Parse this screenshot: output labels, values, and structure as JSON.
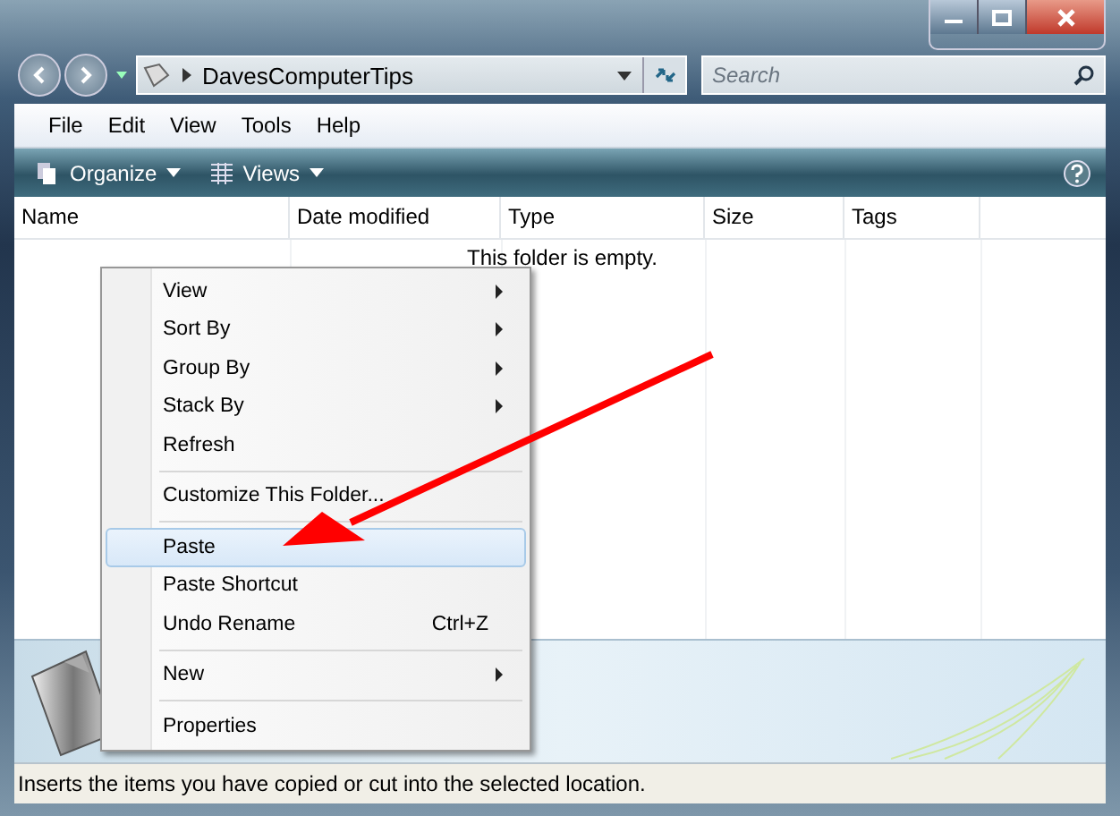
{
  "address_bar": {
    "path": "DavesComputerTips"
  },
  "search": {
    "placeholder": "Search"
  },
  "menu_bar": [
    "File",
    "Edit",
    "View",
    "Tools",
    "Help"
  ],
  "toolbar": [
    {
      "label": "Organize"
    },
    {
      "label": "Views"
    }
  ],
  "columns": [
    "Name",
    "Date modified",
    "Type",
    "Size",
    "Tags"
  ],
  "empty_message": "This folder is empty.",
  "context_menu": [
    {
      "kind": "item",
      "label": "View",
      "submenu": true,
      "selected": false
    },
    {
      "kind": "item",
      "label": "Sort By",
      "submenu": true,
      "selected": false
    },
    {
      "kind": "item",
      "label": "Group By",
      "submenu": true,
      "selected": false
    },
    {
      "kind": "item",
      "label": "Stack By",
      "submenu": true,
      "selected": false
    },
    {
      "kind": "item",
      "label": "Refresh",
      "submenu": false,
      "selected": false
    },
    {
      "kind": "separator"
    },
    {
      "kind": "item",
      "label": "Customize This Folder...",
      "submenu": false,
      "selected": false
    },
    {
      "kind": "separator"
    },
    {
      "kind": "item",
      "label": "Paste",
      "submenu": false,
      "selected": true
    },
    {
      "kind": "item",
      "label": "Paste Shortcut",
      "submenu": false,
      "selected": false
    },
    {
      "kind": "item",
      "label": "Undo Rename",
      "shortcut": "Ctrl+Z",
      "submenu": false,
      "selected": false
    },
    {
      "kind": "separator"
    },
    {
      "kind": "item",
      "label": "New",
      "submenu": true,
      "selected": false
    },
    {
      "kind": "separator"
    },
    {
      "kind": "item",
      "label": "Properties",
      "submenu": false,
      "selected": false
    }
  ],
  "status_bar": "Inserts the items you have copied or cut into the selected location."
}
